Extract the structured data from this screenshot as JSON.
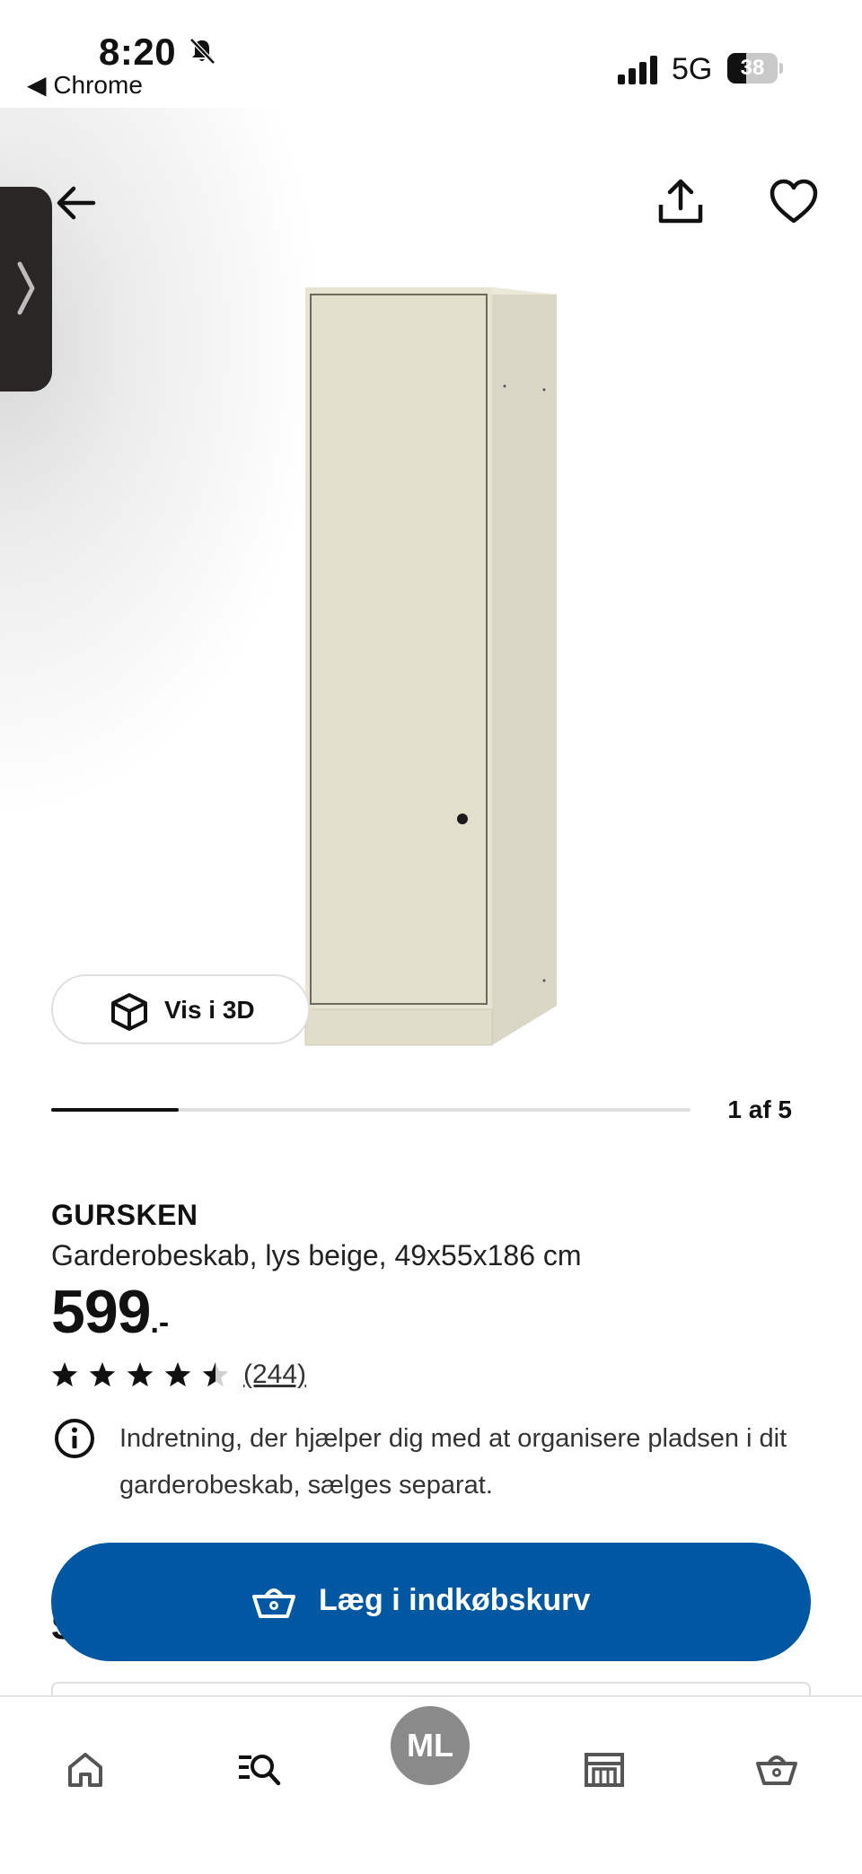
{
  "status_bar": {
    "time": "8:20",
    "back_app_label": "◀ Chrome",
    "network": "5G",
    "battery_level": "38",
    "battery_fraction": 0.38
  },
  "gallery": {
    "vis3d_label": "Vis i 3D",
    "counter": "1 af 5",
    "current_image": 1,
    "total_images": 5
  },
  "product": {
    "name": "GURSKEN",
    "description": "Garderobeskab, lys beige, 49x55x186 cm",
    "price": "599",
    "price_suffix": ".-",
    "rating_value": 4.5,
    "rating_max": 5,
    "review_count": "(244)",
    "info_text": "Indretning, der hjælper dig med at organisere pladsen i dit garderobeskab, sælges separat."
  },
  "cart_button": {
    "label": "Læg i indkøbskurv",
    "color": "#0058a3"
  },
  "partial_text": "S",
  "bottom_nav": {
    "avatar_initials": "ML",
    "tabs": [
      "home-icon",
      "search-list-icon",
      "avatar",
      "store-icon",
      "basket-icon"
    ]
  },
  "icons": {
    "back": "arrow-left-icon",
    "share": "share-icon",
    "favourite": "heart-icon",
    "side_handle": "chevron-right-icon",
    "info": "info-icon",
    "cube": "cube-3d-icon"
  }
}
